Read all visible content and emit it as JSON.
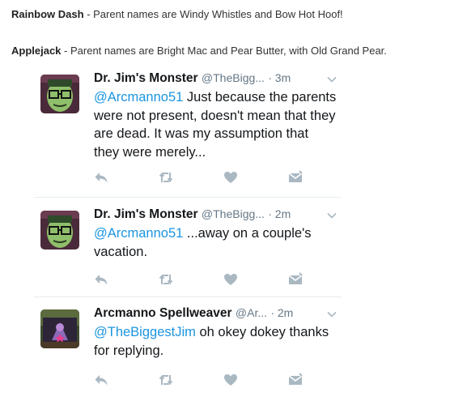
{
  "notes": [
    {
      "name": "Rainbow Dash",
      "sep": " - ",
      "text": "Parent names are Windy Whistles and Bow Hot Hoof!"
    },
    {
      "name": "Applejack",
      "sep": " - ",
      "text": "Parent names are Bright Mac and Pear Butter, with Old Grand Pear."
    }
  ],
  "tweets": [
    {
      "name": "Dr. Jim's Monster",
      "handle": "@TheBigg...",
      "time": "· 3m",
      "mention": "@Arcmanno51",
      "text": " Just because the parents were not present, doesn't mean that they are dead. It was my assumption that they were merely..."
    },
    {
      "name": "Dr. Jim's Monster",
      "handle": "@TheBigg...",
      "time": "· 2m",
      "mention": "@Arcmanno51",
      "text": " ...away on a couple's vacation."
    },
    {
      "name": "Arcmanno Spellweaver",
      "handle": "@Ar...",
      "time": "· 2m",
      "mention": "@TheBiggestJim",
      "text": " oh okey dokey thanks for replying."
    }
  ],
  "icons": [
    "reply-icon",
    "retweet-icon",
    "like-icon",
    "dm-icon",
    "chevron-down-icon"
  ],
  "colors": {
    "mention": "#1b95e0",
    "icon": "#aab8c2",
    "meta": "#657786",
    "divider": "#e6ecf0"
  }
}
